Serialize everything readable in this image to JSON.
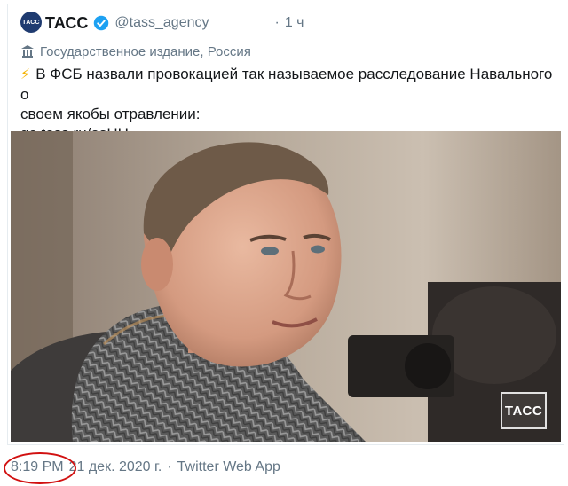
{
  "tweet": {
    "avatar_text": "ТАСС",
    "display_name": "ТАСС",
    "handle": "@tass_agency",
    "separator": "·",
    "time_ago": "1 ч",
    "account_label": "Государственное издание, Россия",
    "text_line1": "В ФСБ назвали провокацией так называемое расследование Навального о",
    "text_line2": "своем якобы отравлении:",
    "link": "go.tass.ru/osHH",
    "photo_watermark": "ТАСС",
    "footer": {
      "time": "8:19 PM",
      "date": "21 дек. 2020 г.",
      "separator": "·",
      "client": "Twitter Web App"
    }
  },
  "colors": {
    "verified": "#1da1f2",
    "muted": "#657786",
    "annotation_circle": "#d11010",
    "bolt": "#f5b301"
  },
  "icons": [
    "verified-badge-icon",
    "government-building-icon",
    "lightning-bolt-icon"
  ]
}
